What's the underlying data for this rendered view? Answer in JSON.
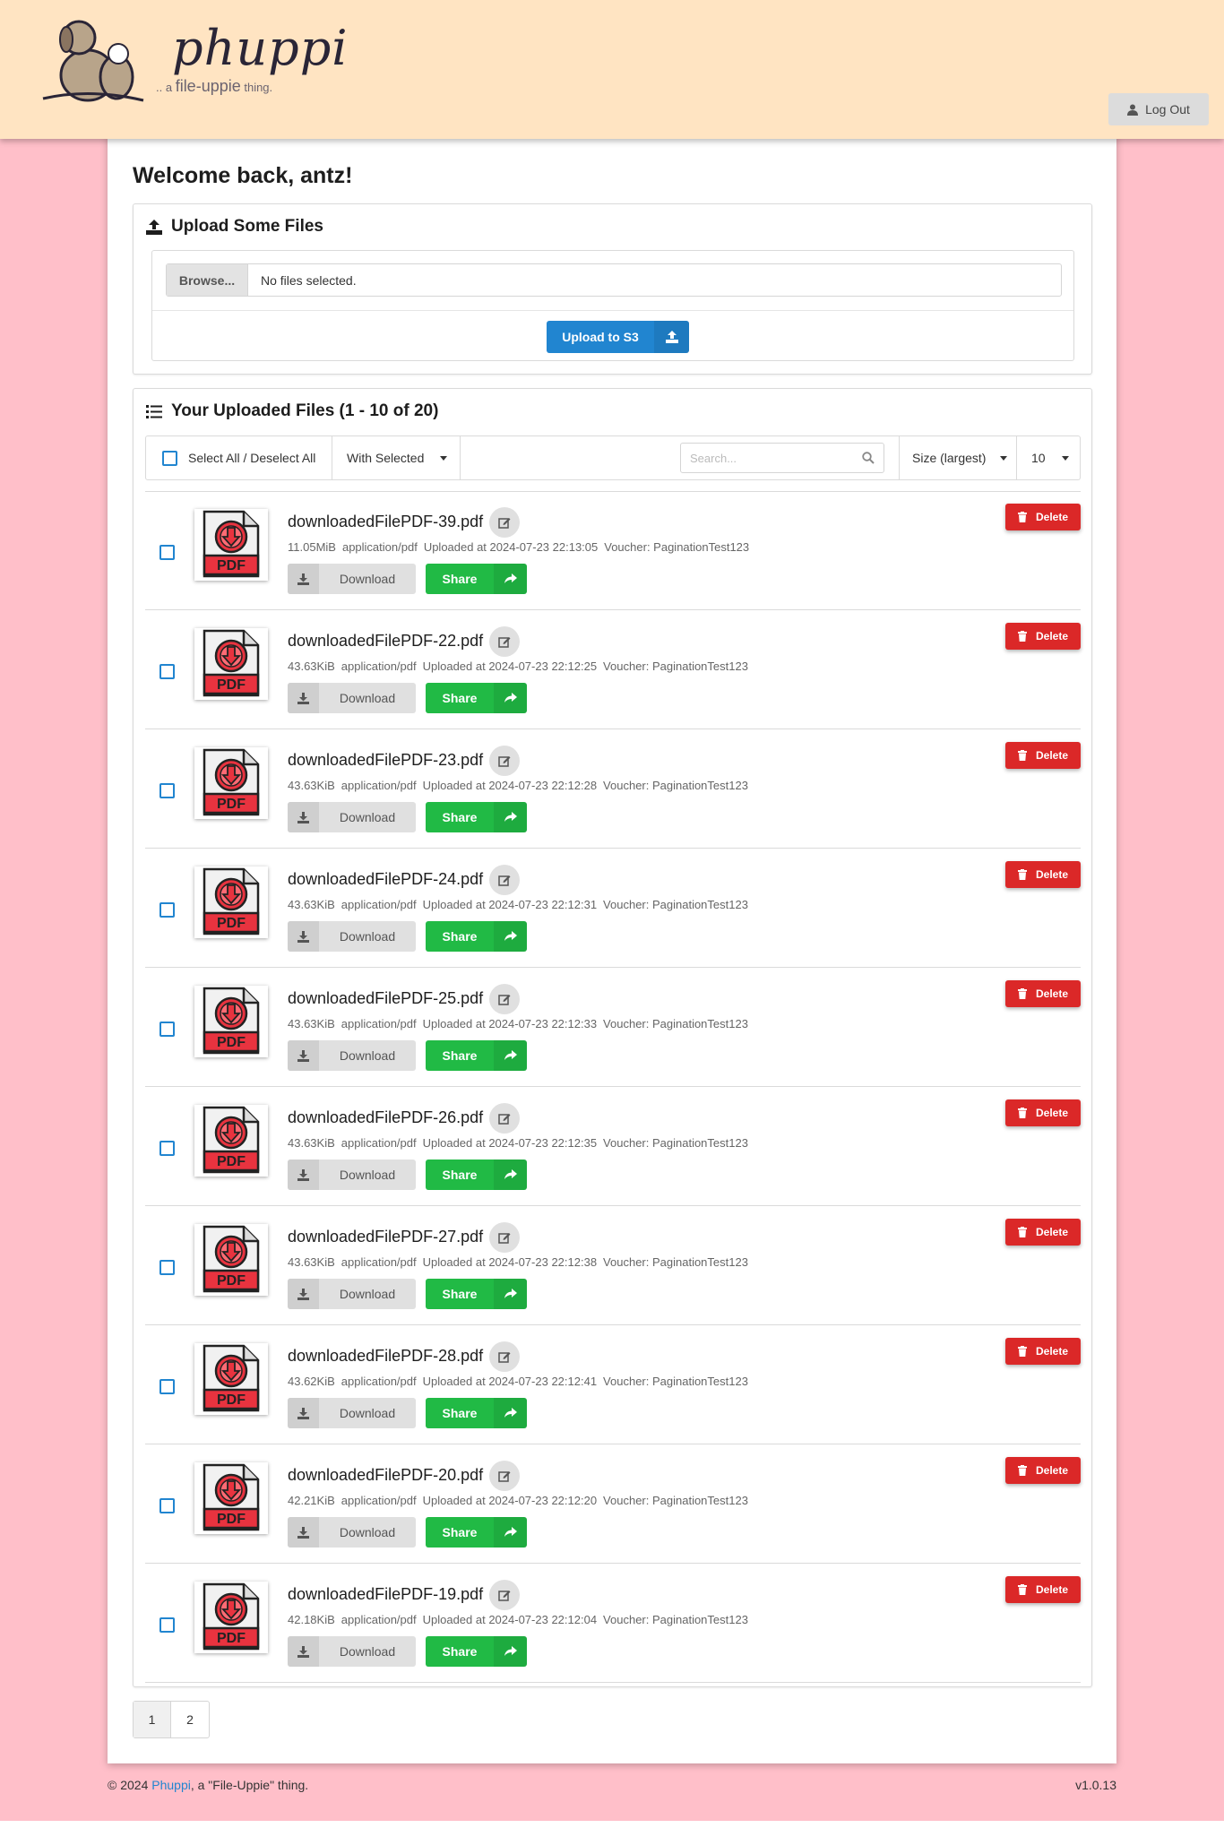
{
  "header": {
    "logo_word": "phuppi",
    "logo_tag_prefix": ".. a ",
    "logo_tag_main": "file-uppie",
    "logo_tag_suffix": " thing.",
    "logout_label": "Log Out"
  },
  "welcome": "Welcome back, antz!",
  "upload": {
    "title": "Upload Some Files",
    "browse_label": "Browse...",
    "no_files_text": "No files selected.",
    "upload_button": "Upload to S3"
  },
  "files": {
    "title": "Your Uploaded Files (1 - 10 of 20)",
    "select_all_label": "Select All / Deselect All",
    "with_selected_label": "With Selected",
    "search_placeholder": "Search...",
    "sort_label": "Size (largest)",
    "per_page": "10",
    "download_label": "Download",
    "share_label": "Share",
    "delete_label": "Delete",
    "thumb_label": "PDF",
    "items": [
      {
        "name": "downloadedFilePDF-39.pdf",
        "size": "11.05MiB",
        "type": "application/pdf",
        "uploaded": "Uploaded at 2024-07-23 22:13:05",
        "voucher": "Voucher: PaginationTest123"
      },
      {
        "name": "downloadedFilePDF-22.pdf",
        "size": "43.63KiB",
        "type": "application/pdf",
        "uploaded": "Uploaded at 2024-07-23 22:12:25",
        "voucher": "Voucher: PaginationTest123"
      },
      {
        "name": "downloadedFilePDF-23.pdf",
        "size": "43.63KiB",
        "type": "application/pdf",
        "uploaded": "Uploaded at 2024-07-23 22:12:28",
        "voucher": "Voucher: PaginationTest123"
      },
      {
        "name": "downloadedFilePDF-24.pdf",
        "size": "43.63KiB",
        "type": "application/pdf",
        "uploaded": "Uploaded at 2024-07-23 22:12:31",
        "voucher": "Voucher: PaginationTest123"
      },
      {
        "name": "downloadedFilePDF-25.pdf",
        "size": "43.63KiB",
        "type": "application/pdf",
        "uploaded": "Uploaded at 2024-07-23 22:12:33",
        "voucher": "Voucher: PaginationTest123"
      },
      {
        "name": "downloadedFilePDF-26.pdf",
        "size": "43.63KiB",
        "type": "application/pdf",
        "uploaded": "Uploaded at 2024-07-23 22:12:35",
        "voucher": "Voucher: PaginationTest123"
      },
      {
        "name": "downloadedFilePDF-27.pdf",
        "size": "43.63KiB",
        "type": "application/pdf",
        "uploaded": "Uploaded at 2024-07-23 22:12:38",
        "voucher": "Voucher: PaginationTest123"
      },
      {
        "name": "downloadedFilePDF-28.pdf",
        "size": "43.62KiB",
        "type": "application/pdf",
        "uploaded": "Uploaded at 2024-07-23 22:12:41",
        "voucher": "Voucher: PaginationTest123"
      },
      {
        "name": "downloadedFilePDF-20.pdf",
        "size": "42.21KiB",
        "type": "application/pdf",
        "uploaded": "Uploaded at 2024-07-23 22:12:20",
        "voucher": "Voucher: PaginationTest123"
      },
      {
        "name": "downloadedFilePDF-19.pdf",
        "size": "42.18KiB",
        "type": "application/pdf",
        "uploaded": "Uploaded at 2024-07-23 22:12:04",
        "voucher": "Voucher: PaginationTest123"
      }
    ]
  },
  "pagination": [
    "1",
    "2"
  ],
  "footer": {
    "copy_prefix": "© 2024 ",
    "brand_link": "Phuppi",
    "copy_suffix": ", a \"File-Uppie\" thing.",
    "version": "v1.0.13"
  },
  "colors": {
    "page_bg": "#ffbfc9",
    "header_bg": "#ffe4c2",
    "primary": "#2185d0",
    "share": "#21ba45",
    "delete": "#db2828"
  }
}
